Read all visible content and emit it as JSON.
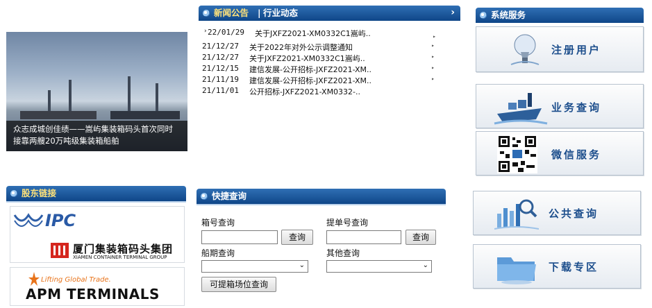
{
  "left_news": {
    "caption_line1": "众志成城创佳绩——嵩屿集装箱码头首次同时",
    "caption_line2": "接靠两艘20万吨级集装箱船舶"
  },
  "news": {
    "tab_active": "新闻公告",
    "tab_other": "行业动态",
    "more": "›",
    "items": [
      {
        "date": "22/01/29",
        "title": "关于JXFZ2021-XM0332C1嵩屿.."
      },
      {
        "date": "21/12/27",
        "title": "关于2022年对外公示调整通知"
      },
      {
        "date": "21/12/27",
        "title": "关于JXFZ2021-XM0332C1嵩屿.."
      },
      {
        "date": "21/12/15",
        "title": "建信发展-公开招标-JXFZ2021-XM.."
      },
      {
        "date": "21/11/19",
        "title": "建信发展-公开招标-JXFZ2021-XM.."
      },
      {
        "date": "21/11/01",
        "title": "公开招标-JXFZ2021-XM0332-.."
      }
    ]
  },
  "services": {
    "title": "系统服务",
    "register": "注册用户",
    "business": "业务查询",
    "wechat": "微信服务",
    "public": "公共查询",
    "download": "下载专区"
  },
  "shareholders": {
    "title": "股东链接",
    "ipc": "IPC",
    "xctg_cn": "厦门集装箱码头集团",
    "xctg_en": "XIAMEN CONTAINER TERMINAL GROUP",
    "apm_slogan": "Lifting Global Trade.",
    "apm_name": "APM TERMINALS"
  },
  "quick_query": {
    "title": "快捷查询",
    "container_label": "箱号查询",
    "bl_label": "提单号查询",
    "schedule_label": "船期查询",
    "other_label": "其他查询",
    "query_button": "查询",
    "yard_button": "可提箱场位查询"
  },
  "colors": {
    "header_blue": "#0f4688",
    "link_blue": "#1c4e8c"
  }
}
